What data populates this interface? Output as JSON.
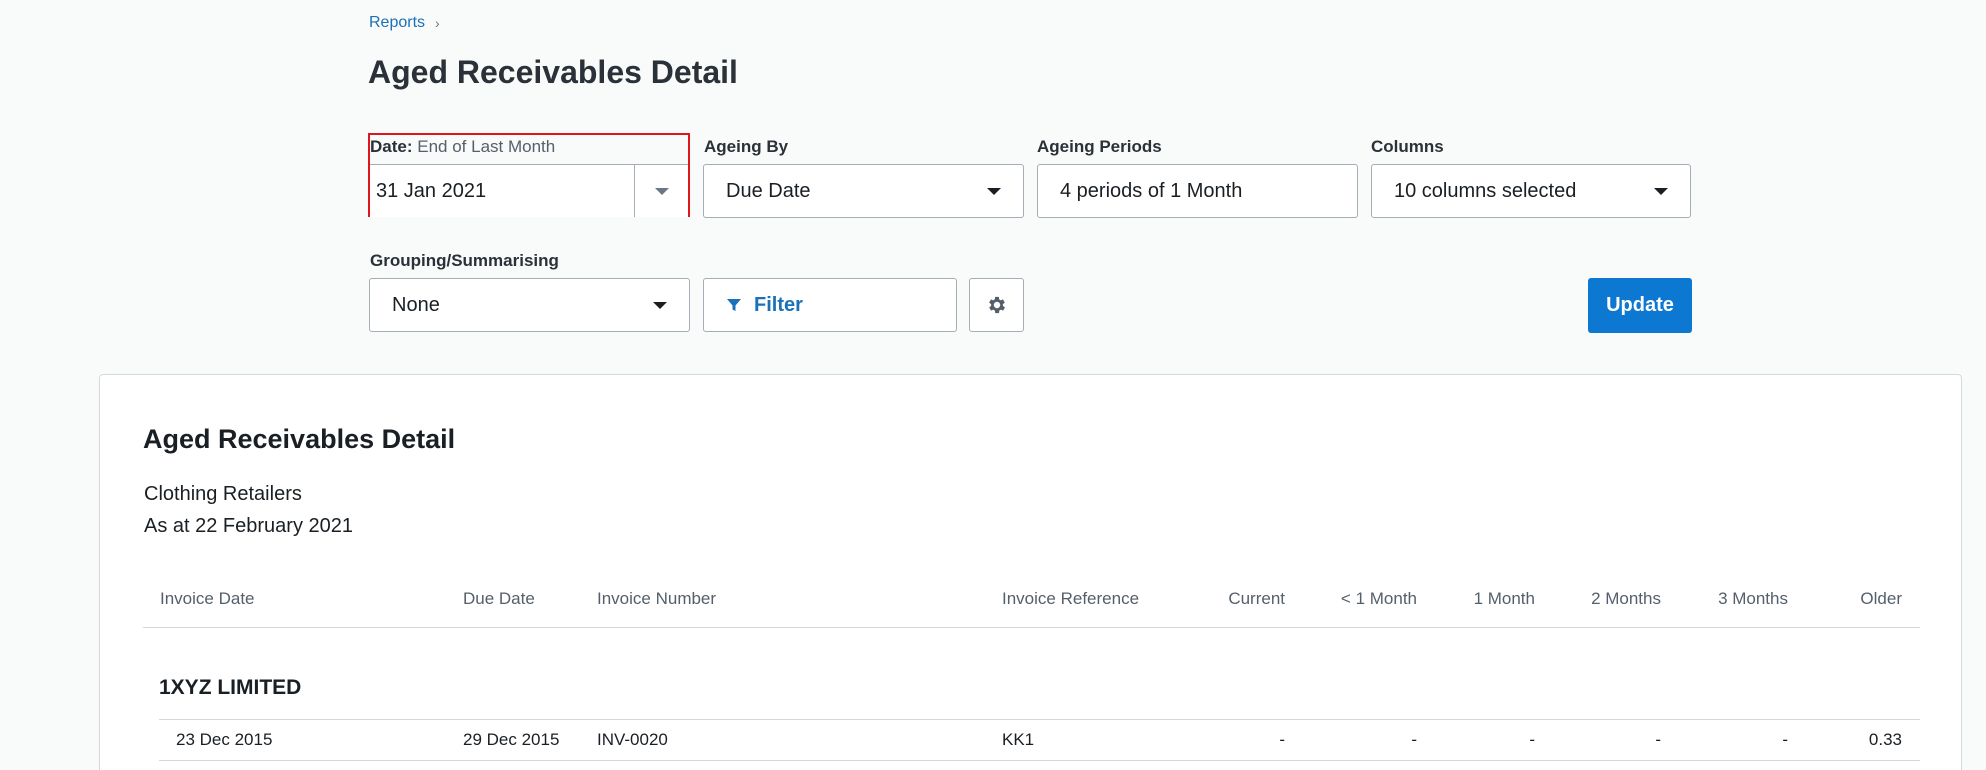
{
  "breadcrumb": {
    "label": "Reports",
    "chevron": "›"
  },
  "page_title": "Aged Receivables Detail",
  "filters": {
    "date": {
      "label": "Date:",
      "sub_label": "End of Last Month",
      "value": "31 Jan 2021"
    },
    "ageing_by": {
      "label": "Ageing By",
      "value": "Due Date"
    },
    "ageing_periods": {
      "label": "Ageing Periods",
      "value": "4 periods of 1 Month"
    },
    "columns": {
      "label": "Columns",
      "value": "10 columns selected"
    },
    "grouping": {
      "label": "Grouping/Summarising",
      "value": "None"
    },
    "filter_label": "Filter",
    "update_label": "Update"
  },
  "report": {
    "title": "Aged Receivables Detail",
    "organisation": "Clothing Retailers",
    "as_at": "As at 22 February 2021",
    "columns": [
      "Invoice Date",
      "Due Date",
      "Invoice Number",
      "Invoice Reference",
      "Current",
      "< 1 Month",
      "1 Month",
      "2 Months",
      "3 Months",
      "Older"
    ],
    "group": "1XYZ LIMITED",
    "rows": [
      {
        "invoice_date": "23 Dec 2015",
        "due_date": "29 Dec 2015",
        "invoice_number": "INV-0020",
        "reference": "KK1",
        "current": "-",
        "lt1": "-",
        "m1": "-",
        "m2": "-",
        "m3": "-",
        "older": "0.33"
      }
    ]
  },
  "colors": {
    "accent": "#0c78d2",
    "highlight": "#e0161d",
    "link": "#1a71b8"
  },
  "icons": {
    "filter": "filter-icon",
    "settings": "gear-icon",
    "dropdown": "chevron-down-icon"
  }
}
